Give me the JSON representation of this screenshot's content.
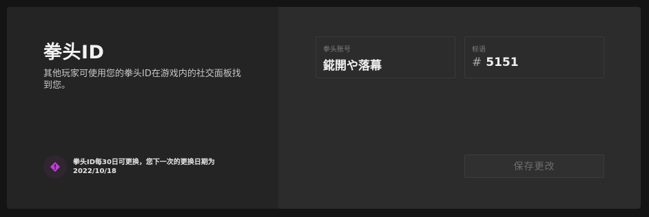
{
  "info": {
    "title": "拳头ID",
    "description": "其他玩家可使用您的拳头ID在游戏内的社交面板找到您。",
    "notice_icon": "alert-diamond-icon",
    "notice_line1": "拳头ID每30日可更换，您下一次的更换日期为",
    "notice_line2": "2022/10/18",
    "accent_color": "#c23dd8"
  },
  "form": {
    "account_label": "拳头账号",
    "account_value": "錵開や落幕",
    "tag_label": "标语",
    "tag_prefix": "#",
    "tag_value": "5151",
    "save_label": "保存更改"
  }
}
